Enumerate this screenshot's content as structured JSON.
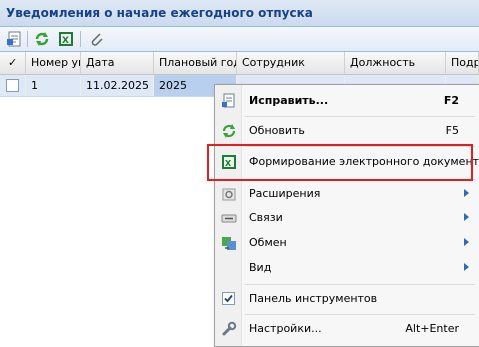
{
  "panel": {
    "title": "Уведомления о начале ежегодного отпуска"
  },
  "toolbar": {
    "icons": [
      "edit-icon",
      "refresh-icon",
      "excel-icon",
      "attach-icon"
    ]
  },
  "grid": {
    "columns": [
      "✓",
      "Номер ув",
      "Дата",
      "Плановый год...",
      "Сотрудник",
      "Должность",
      "Подр"
    ],
    "rows": [
      {
        "number": "1",
        "date": "11.02.2025",
        "year": "2025",
        "employee": "",
        "position": "",
        "dept": ""
      }
    ]
  },
  "context_menu": {
    "edit": {
      "label": "Исправить...",
      "shortcut": "F2"
    },
    "refresh": {
      "label": "Обновить",
      "shortcut": "F5"
    },
    "generate_doc": {
      "label": "Формирование электронного документа"
    },
    "extensions": {
      "label": "Расширения"
    },
    "links": {
      "label": "Связи"
    },
    "exchange": {
      "label": "Обмен"
    },
    "view": {
      "label": "Вид"
    },
    "toolbar_panel": {
      "label": "Панель инструментов",
      "checked": true
    },
    "settings": {
      "label": "Настройки...",
      "shortcut": "Alt+Enter"
    }
  },
  "colors": {
    "highlight": "#e02020",
    "title": "#15428b"
  }
}
